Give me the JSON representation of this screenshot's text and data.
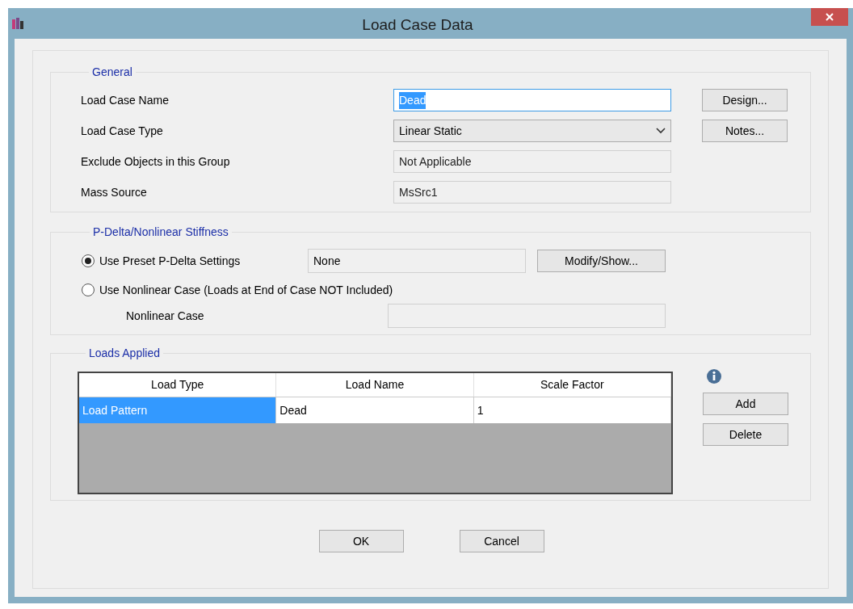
{
  "window": {
    "title": "Load Case Data"
  },
  "general": {
    "title": "General",
    "fields": [
      {
        "label": "Load Case Name",
        "kind": "text",
        "value": "Dead",
        "text_selected": true
      },
      {
        "label": "Load Case Type",
        "kind": "dropdown",
        "value": "Linear Static"
      },
      {
        "label": "Exclude Objects in this Group",
        "kind": "readonly",
        "value": "Not Applicable"
      },
      {
        "label": "Mass Source",
        "kind": "readonly",
        "value": "MsSrc1"
      }
    ],
    "buttons": [
      "Design...",
      "Notes..."
    ]
  },
  "pdelta": {
    "title": "P-Delta/Nonlinear Stiffness",
    "options": [
      {
        "label": "Use Preset P-Delta Settings",
        "selected": true
      },
      {
        "label": "Use Nonlinear Case  (Loads at End of Case NOT Included)",
        "selected": false
      }
    ],
    "preset_value": "None",
    "modify_button": "Modify/Show...",
    "nonlinear_case_label": "Nonlinear Case"
  },
  "loads": {
    "title": "Loads Applied",
    "columns": [
      "Load Type",
      "Load Name",
      "Scale Factor"
    ],
    "rows": [
      {
        "cells": [
          "Load Pattern",
          "Dead",
          "1"
        ],
        "selected": true
      }
    ],
    "buttons": [
      "Add",
      "Delete"
    ]
  },
  "footer_buttons": [
    "OK",
    "Cancel"
  ]
}
